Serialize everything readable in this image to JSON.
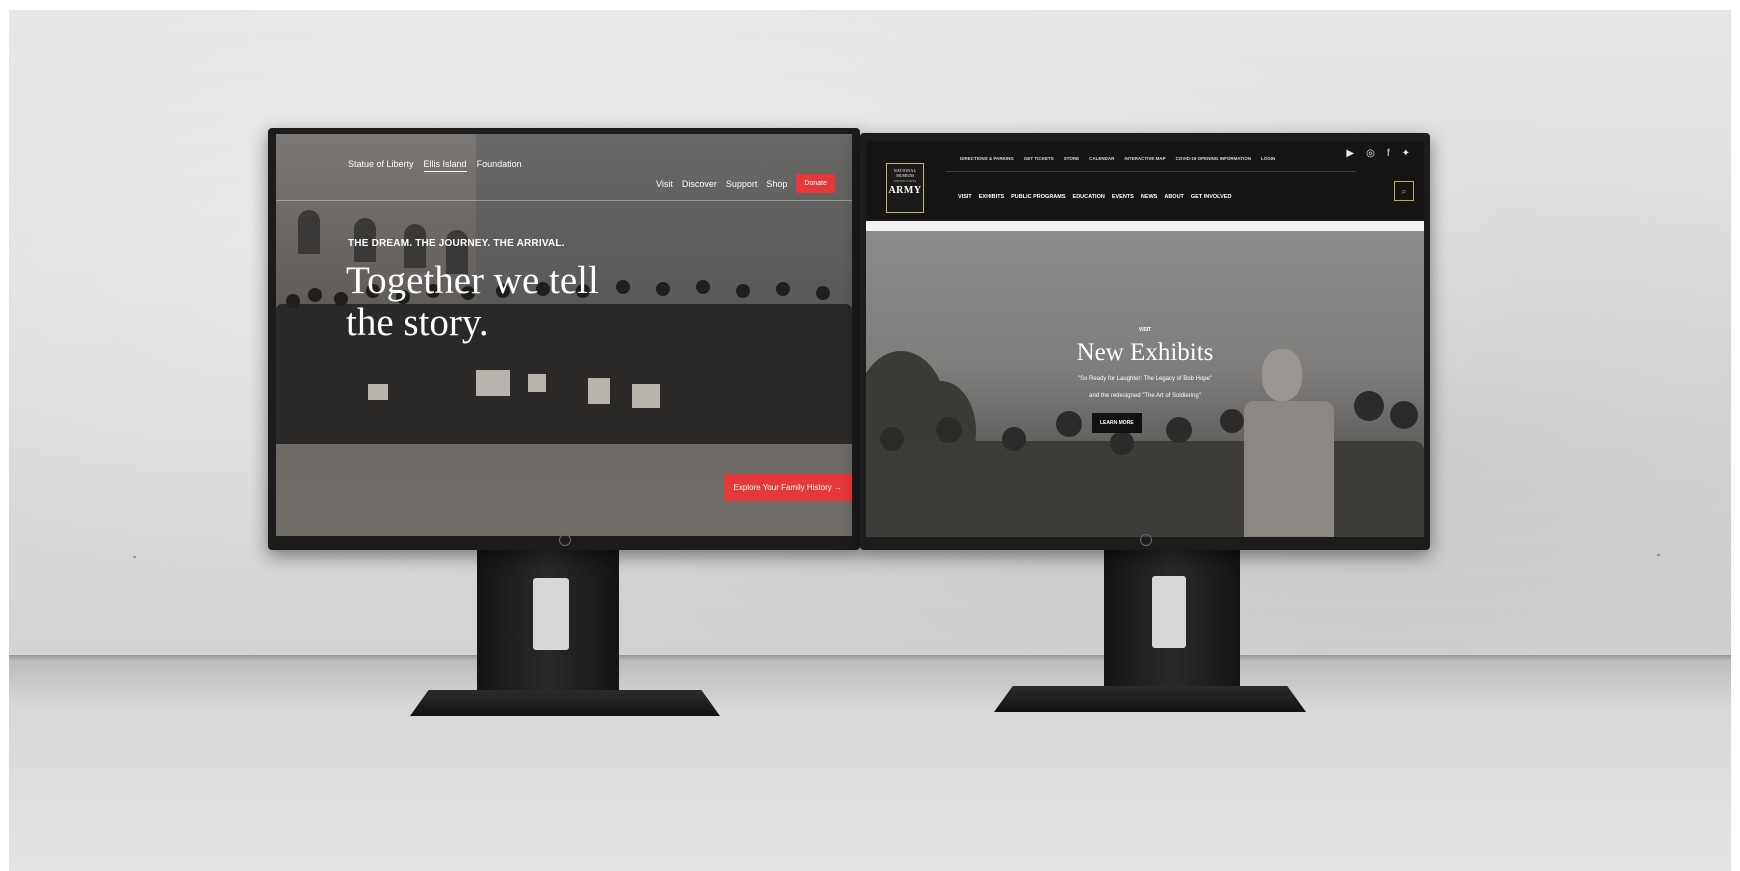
{
  "left_site": {
    "nav_top": [
      "Statue of Liberty",
      "Ellis Island",
      "Foundation"
    ],
    "nav_right": [
      "Visit",
      "Discover",
      "Support",
      "Shop"
    ],
    "donate_label": "Donate",
    "kicker": "THE DREAM. THE JOURNEY. THE ARRIVAL.",
    "headline_line1": "Together we tell",
    "headline_line2": "the story.",
    "cta_label": "Explore Your Family History",
    "cta_arrow": "→",
    "accent_color": "#e5383b"
  },
  "right_site": {
    "logo": {
      "line1": "NATIONAL",
      "line2": "MUSEUM",
      "line3": "UNITED STATES",
      "line4": "ARMY"
    },
    "utility_nav": [
      "DIRECTIONS & PARKING",
      "GET TICKETS",
      "STORE",
      "CALENDAR",
      "INTERACTIVE MAP",
      "COVID-19 OPENING INFORMATION",
      "LOGIN"
    ],
    "main_nav": [
      "VISIT",
      "EXHIBITS",
      "PUBLIC PROGRAMS",
      "EDUCATION",
      "EVENTS",
      "NEWS",
      "ABOUT",
      "GET INVOLVED"
    ],
    "social_icons": [
      "youtube-icon",
      "instagram-icon",
      "facebook-icon",
      "twitter-icon"
    ],
    "social_glyphs": [
      "▶",
      "◎",
      "f",
      "✦"
    ],
    "search_glyph": "⌕",
    "hero_kicker": "VISIT",
    "hero_title": "New Exhibits",
    "hero_sub_line1": "\"So Ready for Laughter: The Legacy of Bob Hope\"",
    "hero_sub_line2": "and the redesigned \"The Art of Soldiering\"",
    "cta_label": "LEARN MORE",
    "accent_color": "#c9a84a"
  }
}
